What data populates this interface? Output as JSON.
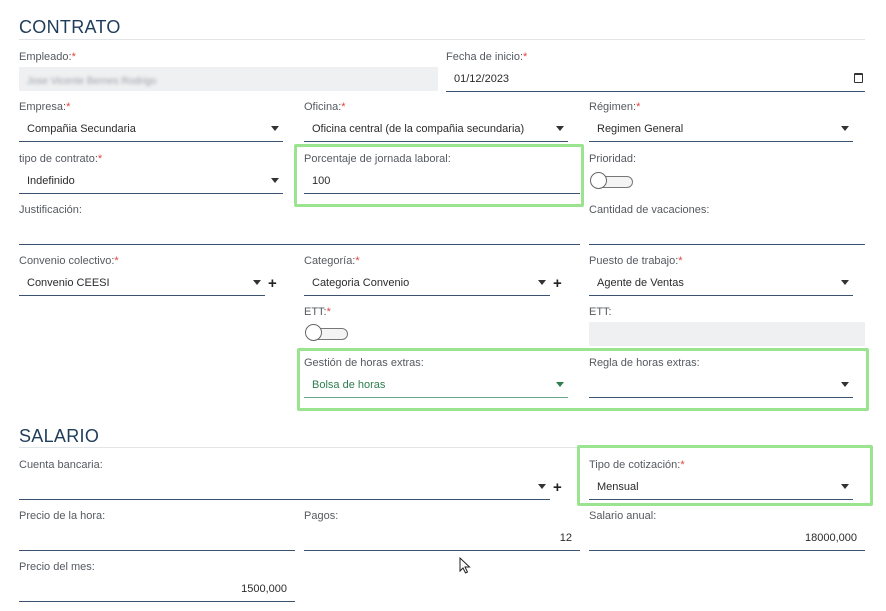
{
  "contrato": {
    "title": "CONTRATO",
    "empleado": {
      "label": "Empleado:",
      "required": "*",
      "value": "Jose Vicente Bernes Rodrigo"
    },
    "fecha_inicio": {
      "label": "Fecha de inicio:",
      "required": "*",
      "value": "01/12/2023"
    },
    "empresa": {
      "label": "Empresa:",
      "required": "*",
      "value": "Compañia Secundaria"
    },
    "oficina": {
      "label": "Oficina:",
      "required": "*",
      "value": "Oficina central (de la compañia secundaria)"
    },
    "regimen": {
      "label": "Régimen:",
      "required": "*",
      "value": "Regimen General"
    },
    "tipo_contrato": {
      "label": "tipo de contrato:",
      "required": "*",
      "value": "Indefinido"
    },
    "porcentaje": {
      "label": "Porcentaje de jornada laboral:",
      "value": "100"
    },
    "prioridad": {
      "label": "Prioridad:",
      "on": false
    },
    "justificacion": {
      "label": "Justificación:",
      "value": ""
    },
    "cantidad_vacaciones": {
      "label": "Cantidad de vacaciones:",
      "value": ""
    },
    "convenio": {
      "label": "Convenio colectivo:",
      "required": "*",
      "value": "Convenio CEESI"
    },
    "categoria": {
      "label": "Categoría:",
      "required": "*",
      "value": "Categoria Convenio"
    },
    "puesto": {
      "label": "Puesto de trabajo:",
      "required": "*",
      "value": "Agente de Ventas"
    },
    "ett": {
      "label": "ETT:",
      "required": "*",
      "on": false
    },
    "ett_field": {
      "label": "ETT:",
      "value": ""
    },
    "gestion_horas": {
      "label": "Gestión de horas extras:",
      "value": "Bolsa de horas"
    },
    "regla_horas": {
      "label": "Regla de horas extras:",
      "value": ""
    }
  },
  "salario": {
    "title": "SALARIO",
    "cuenta_bancaria": {
      "label": "Cuenta bancaria:",
      "value": ""
    },
    "tipo_cotizacion": {
      "label": "Tipo de cotización:",
      "required": "*",
      "value": "Mensual"
    },
    "precio_hora": {
      "label": "Precio de la hora:",
      "value": ""
    },
    "pagos": {
      "label": "Pagos:",
      "value": "12"
    },
    "salario_anual": {
      "label": "Salario anual:",
      "value": "18000,000"
    },
    "precio_mes": {
      "label": "Precio del mes:",
      "value": "1500,000"
    }
  },
  "icons": {
    "plus": "+",
    "dropdown": "caret-down-icon",
    "calendar": "calendar-icon",
    "cursor": "mouse-pointer-icon"
  },
  "colors": {
    "accent": "#1f3c5a",
    "required": "#e0443c",
    "highlight": "#9ae48f",
    "green_value": "#2e7d4f"
  }
}
